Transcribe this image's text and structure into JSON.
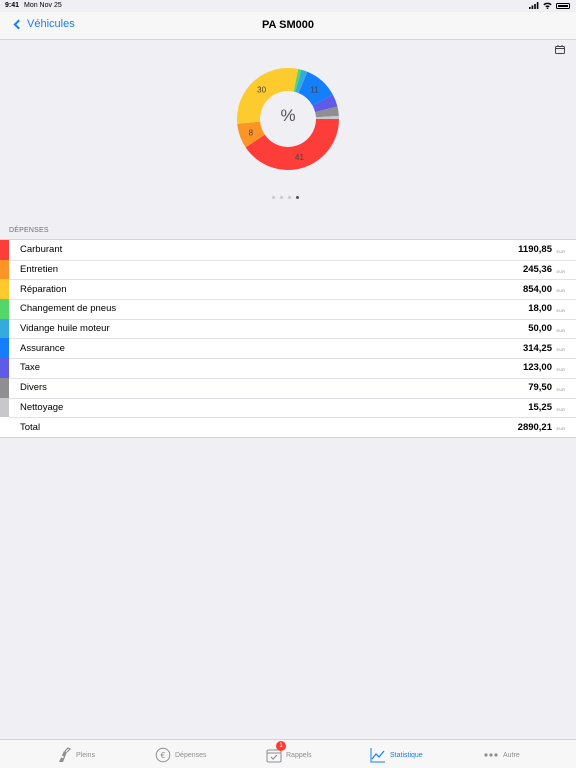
{
  "status_bar": {
    "time": "9:41",
    "date": "Mon Nov 25"
  },
  "nav": {
    "back_label": "Véhicules",
    "title": "PA SM000"
  },
  "chart": {
    "center_label": "%",
    "pages": 4,
    "active_page": 3,
    "chart_data": {
      "type": "pie",
      "categories": [
        "Carburant",
        "Entretien",
        "Réparation",
        "Changement de pneus",
        "Vidange huile moteur",
        "Assurance",
        "Taxe",
        "Divers",
        "Nettoyage"
      ],
      "values": [
        41,
        8,
        30,
        1,
        2,
        11,
        4,
        3,
        1
      ],
      "visible_labels": [
        "41",
        "8",
        "30",
        "",
        "",
        "11",
        "",
        "",
        ""
      ],
      "colors": [
        "#fc3d39",
        "#fd9426",
        "#fecb2e",
        "#53d769",
        "#35aadc",
        "#147efb",
        "#5e5ce6",
        "#8e8e93",
        "#c7c7cc"
      ]
    }
  },
  "section": {
    "header": "DÉPENSES"
  },
  "unit": "EUR",
  "expenses": [
    {
      "label": "Carburant",
      "value": "1190,85",
      "color": "#fc3d39"
    },
    {
      "label": "Entretien",
      "value": "245,36",
      "color": "#fd9426"
    },
    {
      "label": "Réparation",
      "value": "854,00",
      "color": "#fecb2e"
    },
    {
      "label": "Changement de pneus",
      "value": "18,00",
      "color": "#53d769"
    },
    {
      "label": "Vidange huile moteur",
      "value": "50,00",
      "color": "#35aadc"
    },
    {
      "label": "Assurance",
      "value": "314,25",
      "color": "#147efb"
    },
    {
      "label": "Taxe",
      "value": "123,00",
      "color": "#5e5ce6"
    },
    {
      "label": "Divers",
      "value": "79,50",
      "color": "#8e8e93"
    },
    {
      "label": "Nettoyage",
      "value": "15,25",
      "color": "#c7c7cc"
    }
  ],
  "total": {
    "label": "Total",
    "value": "2890,21"
  },
  "tabs": [
    {
      "label": "Pleins",
      "icon": "fuel-pump-icon"
    },
    {
      "label": "Dépenses",
      "icon": "euro-icon"
    },
    {
      "label": "Rappels",
      "icon": "calendar-check-icon",
      "badge": "1"
    },
    {
      "label": "Statistique",
      "icon": "line-chart-icon"
    },
    {
      "label": "Autre",
      "icon": "more-icon"
    }
  ]
}
